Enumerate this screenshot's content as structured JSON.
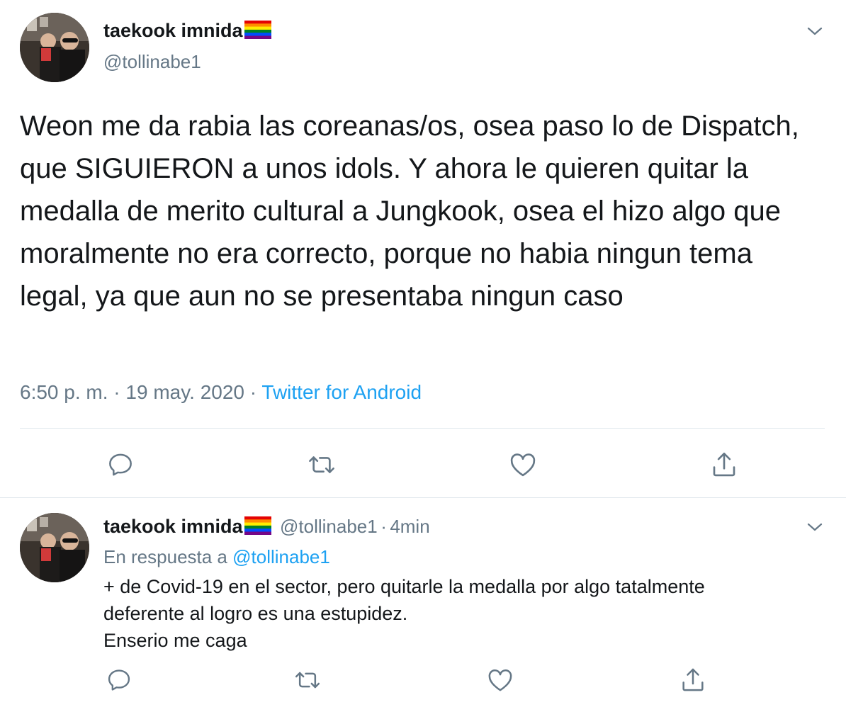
{
  "tweet": {
    "author_name": "taekook imnida",
    "author_flag": "rainbow-flag-emoji",
    "author_handle": "@tollinabe1",
    "text": "Weon me da rabia las coreanas/os, osea paso lo de Dispatch, que SIGUIERON a unos idols. Y ahora le quieren quitar la medalla de merito cultural a Jungkook, osea el hizo algo que moralmente no era correcto, porque no habia ningun tema legal, ya que aun no se presentaba ningun caso",
    "time": "6:50 p. m.",
    "separator": "·",
    "date": "19 may. 2020",
    "source": "Twitter for Android"
  },
  "reply": {
    "author_name": "taekook imnida",
    "author_handle": "@tollinabe1",
    "separator": "·",
    "age": "4min",
    "replying_prefix": "En respuesta a",
    "replying_to": "@tollinabe1",
    "lines": [
      "+ de Covid-19 en el sector, pero quitarle la medalla por algo tatalmente",
      "deferente al logro es una estupidez.",
      "Enserio me caga"
    ]
  },
  "icons": {
    "reply": "comment-icon",
    "retweet": "retweet-icon",
    "like": "heart-icon",
    "share": "share-icon",
    "menu": "chevron-down-icon"
  },
  "colors": {
    "text": "#14171a",
    "secondary": "#657786",
    "link": "#1da1f2",
    "divider": "#e1e8ed"
  }
}
